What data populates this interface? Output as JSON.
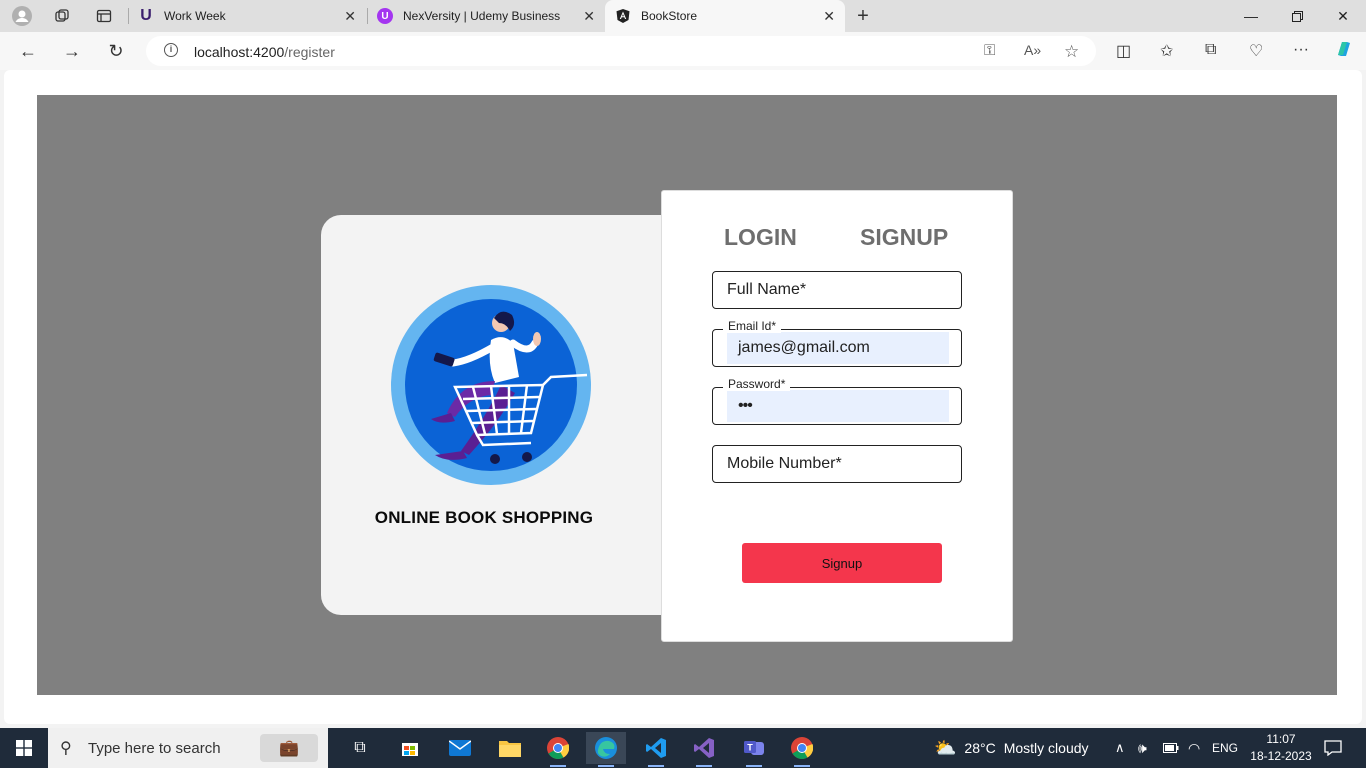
{
  "browser": {
    "tabs": [
      {
        "title": "Work Week",
        "favicon": "U",
        "favicon_color": "#3b1e6e",
        "active": false
      },
      {
        "title": "NexVersity | Udemy Business",
        "favicon": "U",
        "favicon_color": "#a435f0",
        "active": false
      },
      {
        "title": "BookStore",
        "favicon": "A",
        "favicon_color": "#222222",
        "active": true
      }
    ],
    "new_tab_icon": "plus-icon",
    "url_host": "localhost:4200",
    "url_path": "/register"
  },
  "page": {
    "left_card": {
      "brand_text": "ONLINE BOOK SHOPPING",
      "illustration": "shopping-cart-woman-illustration"
    },
    "auth_tabs": {
      "login": "LOGIN",
      "signup": "SIGNUP"
    },
    "form": {
      "full_name_placeholder": "Full Name*",
      "email_label": "Email Id*",
      "email_value": "james@gmail.com",
      "password_label": "Password*",
      "password_mask": "•••",
      "mobile_placeholder": "Mobile Number*",
      "submit_label": "Signup"
    },
    "colors": {
      "stage_bg": "#808080",
      "button_bg": "#f4364c",
      "autofill_bg": "#e8f0fe"
    }
  },
  "taskbar": {
    "search_placeholder": "Type here to search",
    "weather_temp": "28°C",
    "weather_text": "Mostly cloudy",
    "language": "ENG",
    "time": "11:07",
    "date": "18-12-2023"
  }
}
